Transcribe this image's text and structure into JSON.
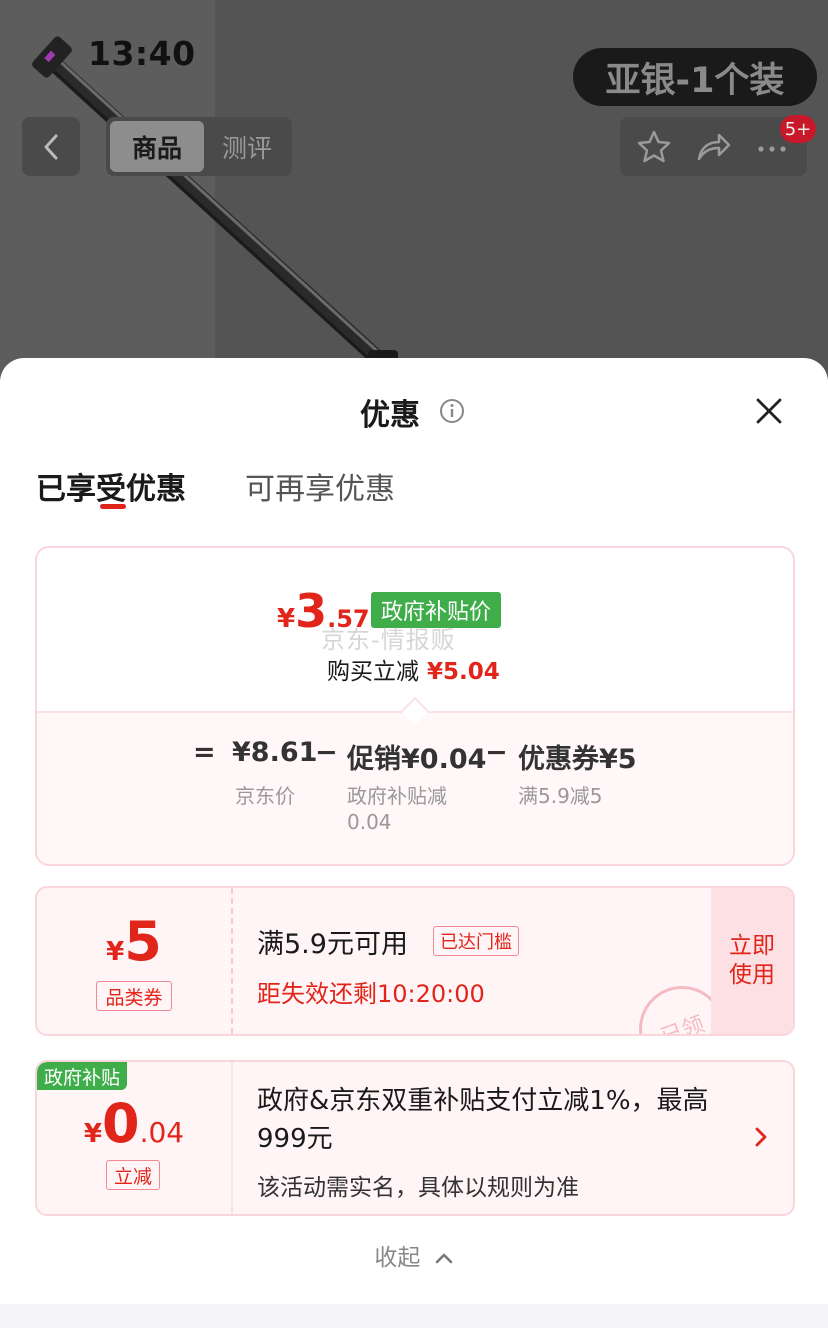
{
  "status_bar": {
    "time": "13:40"
  },
  "product_header": {
    "sku_badge": "亚银-1个装",
    "tabs": [
      "商品",
      "测评"
    ],
    "notification_count": "5+"
  },
  "sheet": {
    "title": "优惠",
    "tabs": {
      "enjoyed": "已享受优惠",
      "more": "可再享优惠"
    },
    "summary": {
      "price_currency": "¥",
      "price_int": "3",
      "price_dec": ".57",
      "price_tag": "政府补贴价",
      "watermark": "京东-情报贩",
      "reduce_label": "购买立减",
      "reduce_amount": "¥5.04",
      "eq_sign": "=",
      "jd_price": "¥8.61",
      "jd_price_label": "京东价",
      "minus1": "−",
      "promo": "促销¥0.04",
      "promo_label": "政府补贴减0.04",
      "minus2": "−",
      "coupon": "优惠券¥5",
      "coupon_label": "满5.9减5"
    },
    "coupon_card": {
      "currency": "¥",
      "value": "5",
      "type": "品类券",
      "condition": "满5.9元可用",
      "reached": "已达门槛",
      "expire": "距失效还剩10:20:00",
      "use_button": "立即使用",
      "stamp": "已领"
    },
    "gov_card": {
      "label": "政府补贴",
      "currency": "¥",
      "value_int": "0",
      "value_dec": ".04",
      "type": "立减",
      "description": "政府&京东双重补贴支付立减1%，最高999元",
      "note": "该活动需实名，具体以规则为准"
    },
    "collapse": "收起"
  },
  "colors": {
    "accent": "#e1251b",
    "gov_green": "#3fae4a",
    "border_pink": "#fad6dc"
  }
}
